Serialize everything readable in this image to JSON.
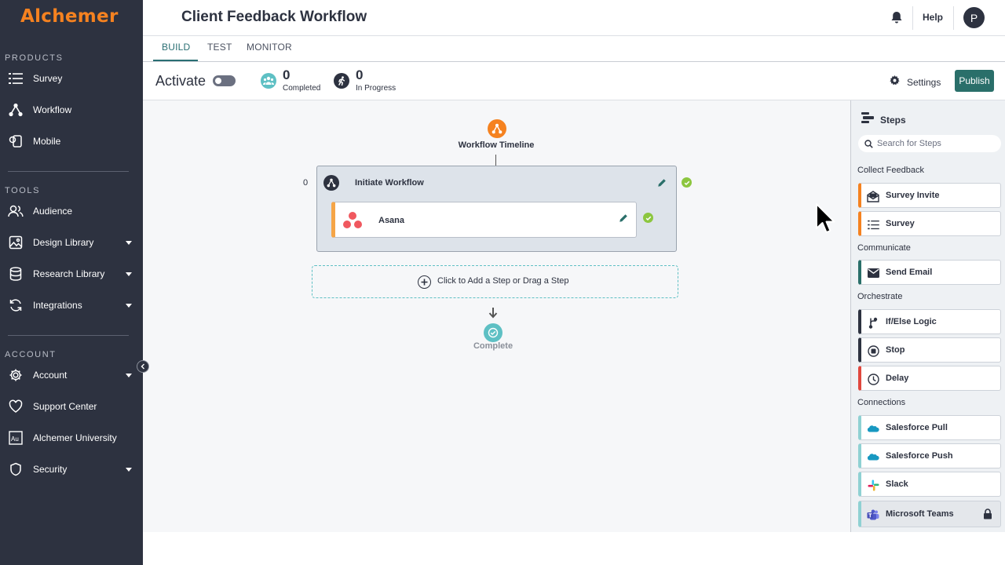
{
  "app": {
    "logo": "Alchemer",
    "brand_color": "#f58220",
    "accent_color": "#2a6f6a"
  },
  "sidebar": {
    "sections": [
      {
        "label": "PRODUCTS"
      },
      {
        "label": "TOOLS"
      },
      {
        "label": "ACCOUNT"
      }
    ],
    "items": [
      {
        "label": "Survey",
        "icon": "survey-list-icon",
        "has_caret": false
      },
      {
        "label": "Workflow",
        "icon": "workflow-icon",
        "has_caret": false
      },
      {
        "label": "Mobile",
        "icon": "mobile-icon",
        "has_caret": false
      },
      {
        "label": "Audience",
        "icon": "audience-icon",
        "has_caret": false
      },
      {
        "label": "Design Library",
        "icon": "image-icon",
        "has_caret": true
      },
      {
        "label": "Research Library",
        "icon": "database-icon",
        "has_caret": true
      },
      {
        "label": "Integrations",
        "icon": "sync-icon",
        "has_caret": true
      },
      {
        "label": "Account",
        "icon": "gear-icon",
        "has_caret": true
      },
      {
        "label": "Support Center",
        "icon": "heart-icon",
        "has_caret": false
      },
      {
        "label": "Alchemer University",
        "icon": "university-icon",
        "has_caret": false
      },
      {
        "label": "Security",
        "icon": "shield-icon",
        "has_caret": true
      }
    ]
  },
  "header": {
    "title": "Client Feedback Workflow",
    "help": "Help",
    "avatar_initial": "P"
  },
  "tabs": [
    {
      "label": "BUILD",
      "active": true
    },
    {
      "label": "TEST",
      "active": false
    },
    {
      "label": "MONITOR",
      "active": false
    }
  ],
  "toolbar": {
    "activate_label": "Activate",
    "activated": false,
    "completed": {
      "value": "0",
      "label": "Completed"
    },
    "in_progress": {
      "value": "0",
      "label": "In Progress"
    },
    "settings_label": "Settings",
    "publish_label": "Publish"
  },
  "canvas": {
    "timeline_title": "Workflow Timeline",
    "initiate_count": "0",
    "initiate_title": "Initiate Workflow",
    "asana_label": "Asana",
    "add_step_label": "Click to Add a Step or Drag a Step",
    "complete_label": "Complete"
  },
  "steps_panel": {
    "title": "Steps",
    "search_placeholder": "Search for Steps",
    "groups": [
      {
        "label": "Collect Feedback"
      },
      {
        "label": "Communicate"
      },
      {
        "label": "Orchestrate"
      },
      {
        "label": "Connections"
      }
    ],
    "cards": [
      {
        "label": "Survey Invite",
        "icon": "envelope-open-icon",
        "color": "#f58220"
      },
      {
        "label": "Survey",
        "icon": "survey-list-icon",
        "color": "#f58220"
      },
      {
        "label": "Send Email",
        "icon": "envelope-icon",
        "color": "#2a6f6a"
      },
      {
        "label": "If/Else Logic",
        "icon": "branch-icon",
        "color": "#2d3240"
      },
      {
        "label": "Stop",
        "icon": "stop-icon",
        "color": "#2d3240"
      },
      {
        "label": "Delay",
        "icon": "clock-icon",
        "color": "#e0483e"
      },
      {
        "label": "Salesforce Pull",
        "icon": "salesforce-icon",
        "color": "#8fd1d3"
      },
      {
        "label": "Salesforce Push",
        "icon": "salesforce-icon",
        "color": "#8fd1d3"
      },
      {
        "label": "Slack",
        "icon": "slack-icon",
        "color": "#8fd1d3"
      },
      {
        "label": "Microsoft Teams",
        "icon": "teams-icon",
        "color": "#8fd1d3",
        "locked": true
      }
    ]
  }
}
